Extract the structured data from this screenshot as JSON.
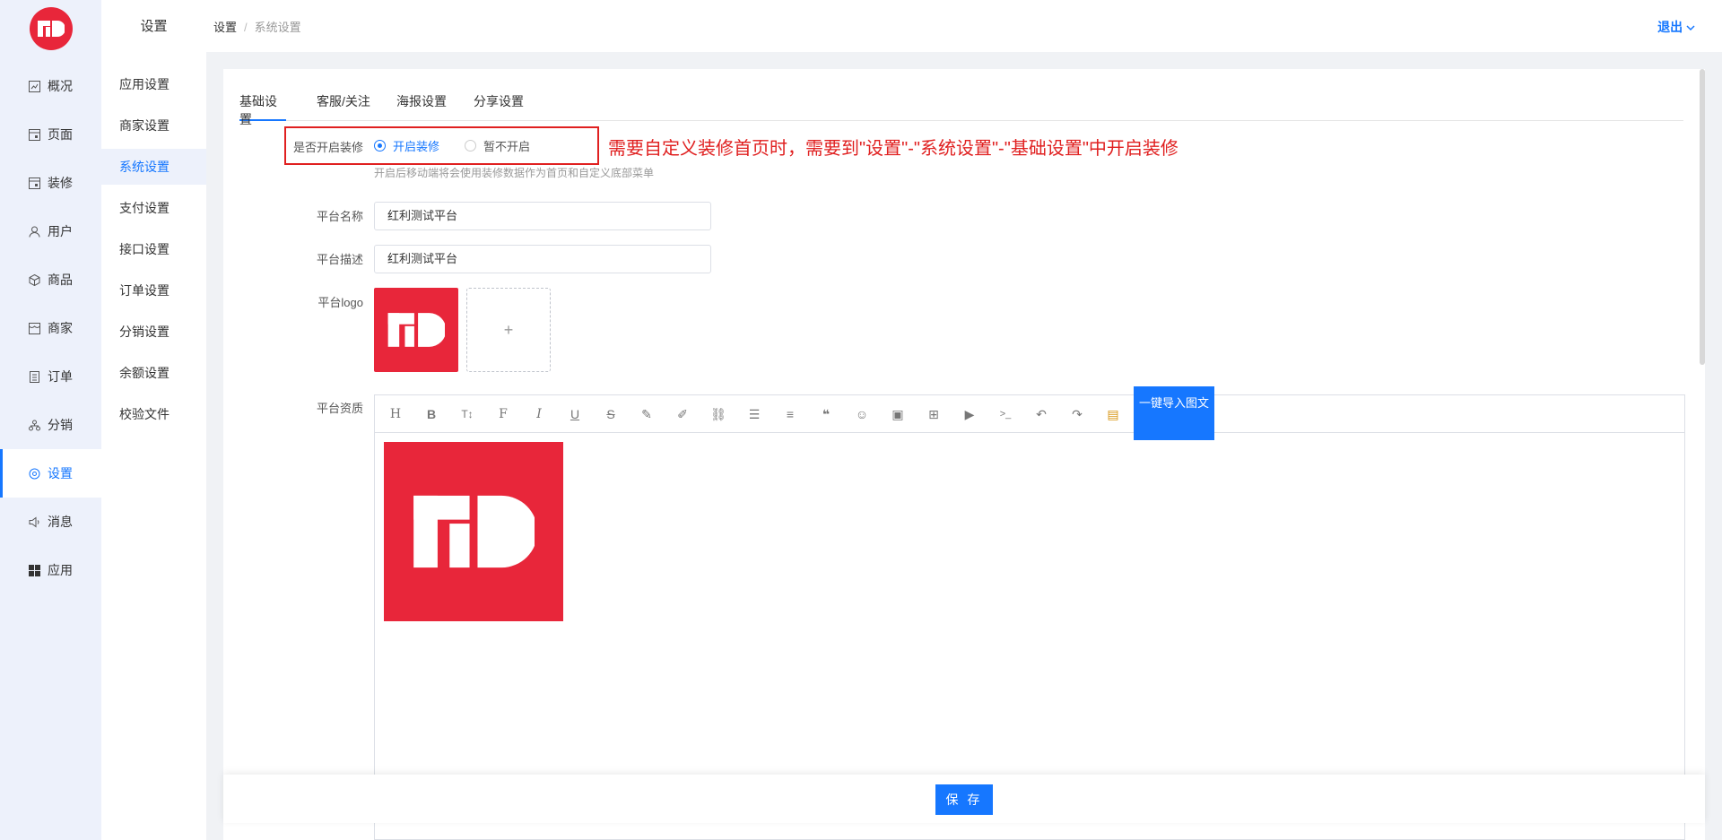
{
  "sidebar": {
    "items": [
      {
        "label": "概况",
        "icon": "chart-icon"
      },
      {
        "label": "页面",
        "icon": "page-icon"
      },
      {
        "label": "装修",
        "icon": "decorate-icon"
      },
      {
        "label": "用户",
        "icon": "user-icon"
      },
      {
        "label": "商品",
        "icon": "box-icon"
      },
      {
        "label": "商家",
        "icon": "store-icon"
      },
      {
        "label": "订单",
        "icon": "order-icon"
      },
      {
        "label": "分销",
        "icon": "distribution-icon"
      },
      {
        "label": "设置",
        "icon": "gear-icon"
      },
      {
        "label": "消息",
        "icon": "speaker-icon"
      },
      {
        "label": "应用",
        "icon": "grid-icon"
      }
    ],
    "active": "设置"
  },
  "subnav": {
    "title": "设置",
    "items": [
      "应用设置",
      "商家设置",
      "系统设置",
      "支付设置",
      "接口设置",
      "订单设置",
      "分销设置",
      "余额设置",
      "校验文件"
    ],
    "active": "系统设置"
  },
  "header": {
    "breadcrumb": [
      "设置",
      "系统设置"
    ],
    "logout": "退出"
  },
  "tabs": [
    "基础设置",
    "客服/关注",
    "海报设置",
    "分享设置"
  ],
  "form": {
    "decorate_label": "是否开启装修",
    "decorate_on": "开启装修",
    "decorate_off": "暂不开启",
    "decorate_hint": "开启后移动端将会使用装修数据作为首页和自定义底部菜单",
    "annotation": "需要自定义装修首页时，需要到\"设置\"-\"系统设置\"-\"基础设置\"中开启装修",
    "name_label": "平台名称",
    "name_value": "红利测试平台",
    "desc_label": "平台描述",
    "desc_value": "红利测试平台",
    "logo_label": "平台logo",
    "upload_plus": "+",
    "qual_label": "平台资质",
    "import_btn": "一键导入图文"
  },
  "save": "保 存",
  "colors": {
    "accent": "#1677ff",
    "brand": "#e8263a",
    "annotation": "#e02020"
  }
}
